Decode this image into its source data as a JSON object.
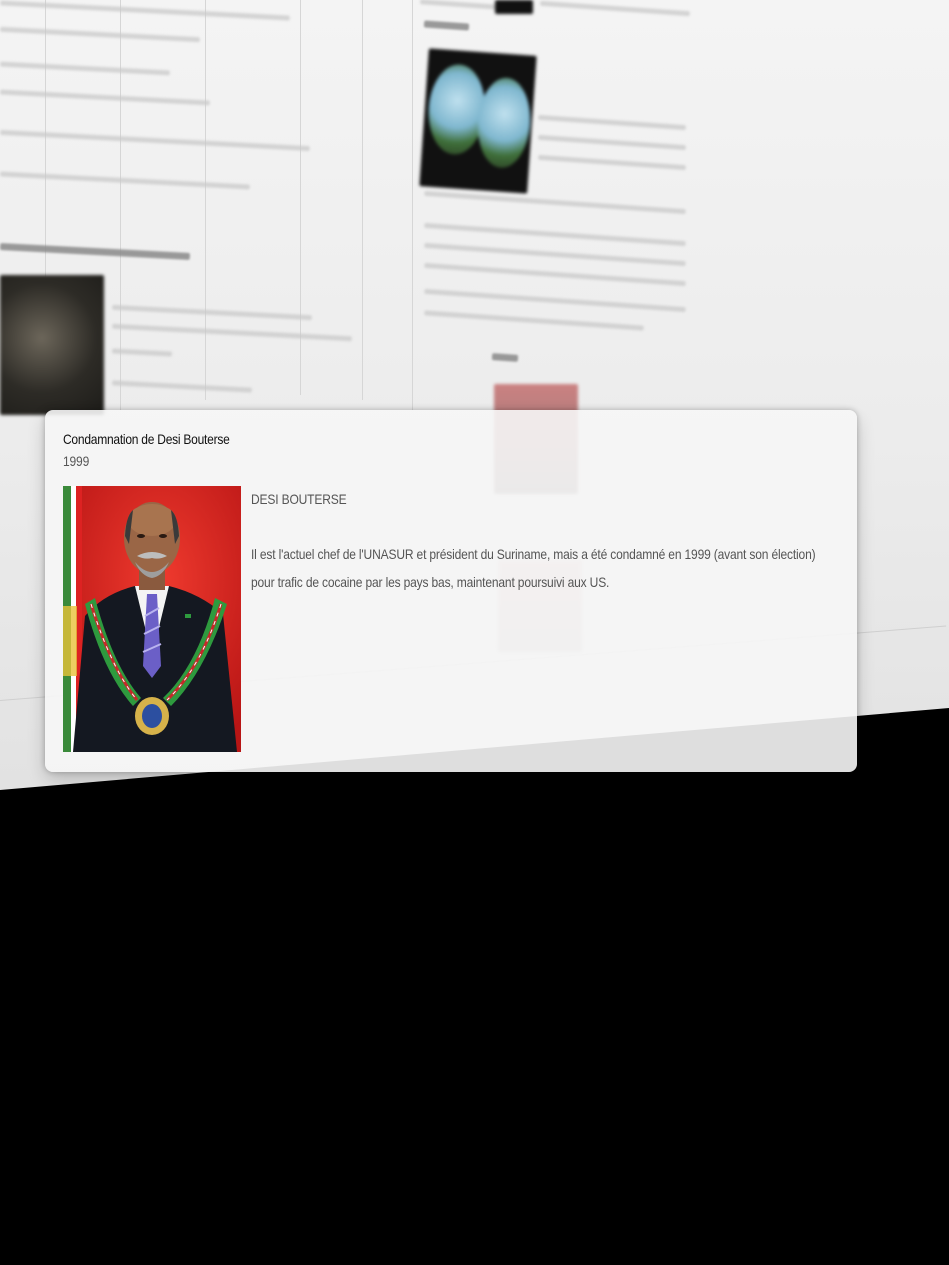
{
  "popup": {
    "title": "Condamnation de Desi Bouterse",
    "year": "1999",
    "heading": "DESI BOUTERSE",
    "body": "Il est l'actuel chef de l'UNASUR et président du Suriname, mais a été condamné en 1999 (avant son élection) pour trafic de cocaine par les pays bas, maintenant poursuivi aux US.",
    "image": {
      "subject": "portrait-photo",
      "background_color": "#d22323"
    }
  },
  "colors": {
    "screen_background": "#000000",
    "card_background": "#f6f6f6",
    "title_text": "#111111",
    "secondary_text": "#555555"
  }
}
